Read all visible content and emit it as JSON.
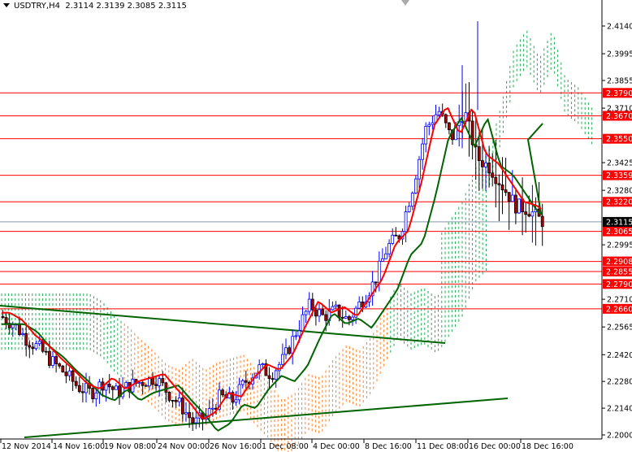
{
  "header": {
    "symbol": "USDTRY,H4",
    "ohlc": "2.3114 2.3139 2.3085 2.3115"
  },
  "colors": {
    "level": "#ff0000",
    "current": "#000000",
    "bull_outline": "#0000ff",
    "bear_body": "#b00000",
    "kijun": "#ff0000",
    "tenkan": "#006400",
    "trend": "#006400",
    "cloud_up": "#22aa55",
    "cloud_down": "#ff7f27"
  },
  "chart_data": {
    "type": "candlestick",
    "timeframe": "H4",
    "ylim": [
      2.2,
      2.414
    ],
    "y_ticks": [
      "2.4140",
      "2.3995",
      "2.3855",
      "2.3710",
      "2.3425",
      "2.3280",
      "2.2995",
      "2.2710",
      "2.2565",
      "2.2420",
      "2.2280",
      "2.2140",
      "2.2000"
    ],
    "x_ticks": [
      "12 Nov 2014",
      "14 Nov 16:00",
      "19 Nov 08:00",
      "24 Nov 00:00",
      "26 Nov 16:00",
      "1 Dec 08:00",
      "4 Dec 00:00",
      "8 Dec 16:00",
      "11 Dec 08:00",
      "16 Dec 00:00",
      "18 Dec 16:00"
    ],
    "levels": [
      "2.3790",
      "2.3670",
      "2.3550",
      "2.3359",
      "2.3220",
      "2.3065",
      "2.2908",
      "2.2855",
      "2.2790",
      "2.2660"
    ],
    "current_price": "2.3115",
    "approx_close_path": [
      2.262,
      2.258,
      2.25,
      2.245,
      2.238,
      2.232,
      2.225,
      2.222,
      2.228,
      2.222,
      2.226,
      2.228,
      2.23,
      2.222,
      2.215,
      2.206,
      2.21,
      2.22,
      2.218,
      2.228,
      2.235,
      2.232,
      2.24,
      2.255,
      2.268,
      2.262,
      2.265,
      2.26,
      2.27,
      2.28,
      2.298,
      2.305,
      2.33,
      2.36,
      2.37,
      2.355,
      2.37,
      2.345,
      2.34,
      2.33,
      2.32,
      2.318,
      2.312
    ]
  }
}
